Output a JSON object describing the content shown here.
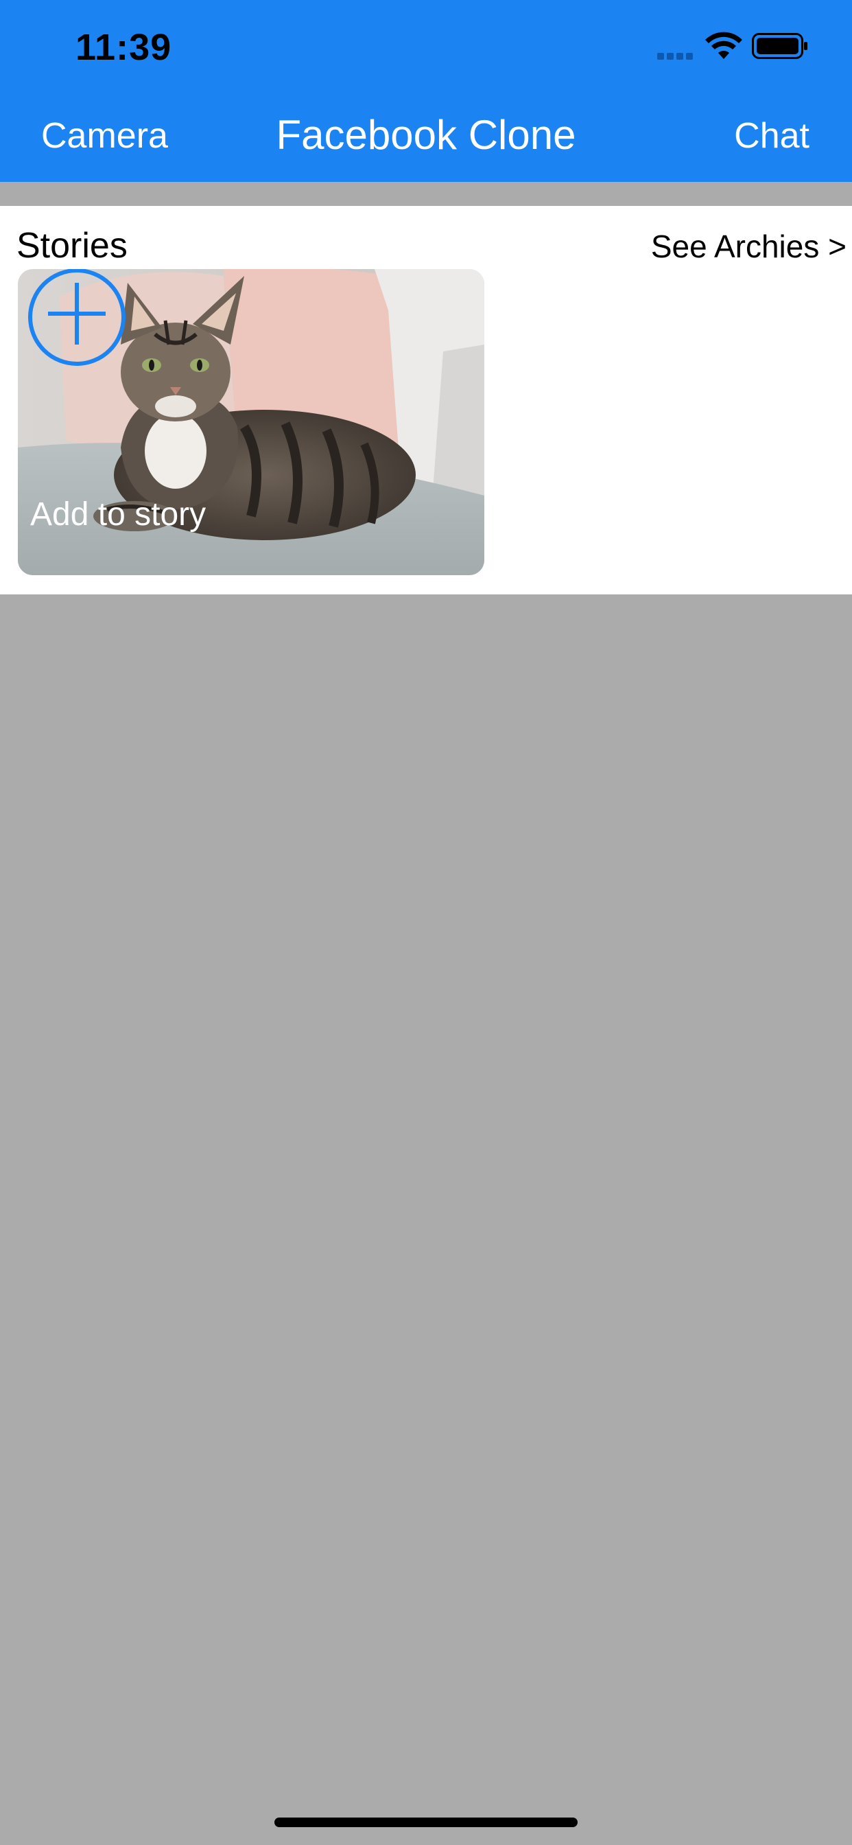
{
  "status_bar": {
    "time": "11:39"
  },
  "nav": {
    "left_label": "Camera",
    "title": "Facebook Clone",
    "right_label": "Chat"
  },
  "stories": {
    "title": "Stories",
    "see_archives_label": "See Archies >",
    "cards": [
      {
        "label": "Add to story",
        "icon": "plus-circle-icon",
        "image": "tabby-cat-on-sofa"
      }
    ]
  },
  "colors": {
    "header_background": "#1c83f3",
    "page_background": "#ababab",
    "card_background": "#ffffff",
    "add_icon": "#1c83f3"
  },
  "icons": {
    "signal": "cellular-signal-icon",
    "wifi": "wifi-icon",
    "battery": "battery-icon"
  }
}
